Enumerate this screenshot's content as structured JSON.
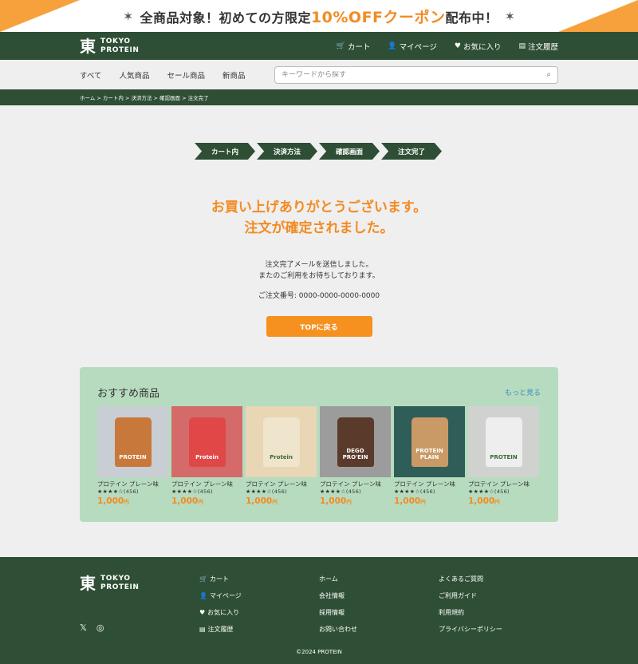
{
  "promo": {
    "pre": "全商品対象！初めての方限定",
    "highlight": "10%OFFクーポン",
    "post": "配布中！"
  },
  "brand": {
    "line1": "TOKYO",
    "line2": "PROTEIN",
    "mark": "東"
  },
  "header_nav": [
    {
      "icon": "cart-icon",
      "glyph": "🛒",
      "label": "カート"
    },
    {
      "icon": "user-icon",
      "glyph": "👤",
      "label": "マイページ"
    },
    {
      "icon": "heart-icon",
      "glyph": "♥",
      "label": "お気に入り"
    },
    {
      "icon": "history-icon",
      "glyph": "▤",
      "label": "注文履歴"
    }
  ],
  "categories": [
    "すべて",
    "人気商品",
    "セール商品",
    "新商品"
  ],
  "search": {
    "placeholder": "キーワードから探す"
  },
  "breadcrumb": "ホーム > カート内 > 決済方法 > 確認画面 > 注文完了",
  "steps": [
    "カート内",
    "決済方法",
    "確認画面",
    "注文完了"
  ],
  "thanks": {
    "line1": "お買い上げありがとうございます。",
    "line2": "注文が確定されました。"
  },
  "message": {
    "line1": "注文完了メールを送信しました。",
    "line2": "またのご利用をお待ちしております。"
  },
  "order_number": "ご注文番号: 0000-0000-0000-0000",
  "top_button": "TOPに戻る",
  "recommend": {
    "title": "おすすめ商品",
    "more": "もっと見る",
    "products": [
      {
        "name": "プロテイン プレーン味",
        "stars": "★★★★☆",
        "count": "(456)",
        "price": "1,000",
        "yen": "円",
        "bag_label": "PROTEIN"
      },
      {
        "name": "プロテイン プレーン味",
        "stars": "★★★★☆",
        "count": "(456)",
        "price": "1,000",
        "yen": "円",
        "bag_label": "Protein"
      },
      {
        "name": "プロテイン プレーン味",
        "stars": "★★★★☆",
        "count": "(456)",
        "price": "1,000",
        "yen": "円",
        "bag_label": "Protein"
      },
      {
        "name": "プロテイン プレーン味",
        "stars": "★★★★☆",
        "count": "(456)",
        "price": "1,000",
        "yen": "円",
        "bag_label": "DEGO PRO'EIN"
      },
      {
        "name": "プロテイン プレーン味",
        "stars": "★★★★☆",
        "count": "(456)",
        "price": "1,000",
        "yen": "円",
        "bag_label": "PROTEIN PLAIN"
      },
      {
        "name": "プロテイン プレーン味",
        "stars": "★★★★☆",
        "count": "(456)",
        "price": "1,000",
        "yen": "円",
        "bag_label": "PROTEIN"
      }
    ]
  },
  "footer": {
    "col1": [
      {
        "icon": "cart-icon",
        "glyph": "🛒",
        "label": "カート"
      },
      {
        "icon": "user-icon",
        "glyph": "👤",
        "label": "マイページ"
      },
      {
        "icon": "heart-icon",
        "glyph": "♥",
        "label": "お気に入り"
      },
      {
        "icon": "history-icon",
        "glyph": "▤",
        "label": "注文履歴"
      }
    ],
    "col2": [
      "ホーム",
      "会社情報",
      "採用情報",
      "お問い合わせ"
    ],
    "col3": [
      "よくあるご質問",
      "ご利用ガイド",
      "利用規約",
      "プライバシーポリシー"
    ],
    "social": [
      {
        "icon": "x-icon",
        "glyph": "𝕏"
      },
      {
        "icon": "instagram-icon",
        "glyph": "◎"
      }
    ],
    "copyright": "©2024 PROTEIN"
  },
  "colors": {
    "brand_green": "#2e4f35",
    "accent_orange": "#f28b22",
    "rec_bg": "#b7dbbf"
  }
}
